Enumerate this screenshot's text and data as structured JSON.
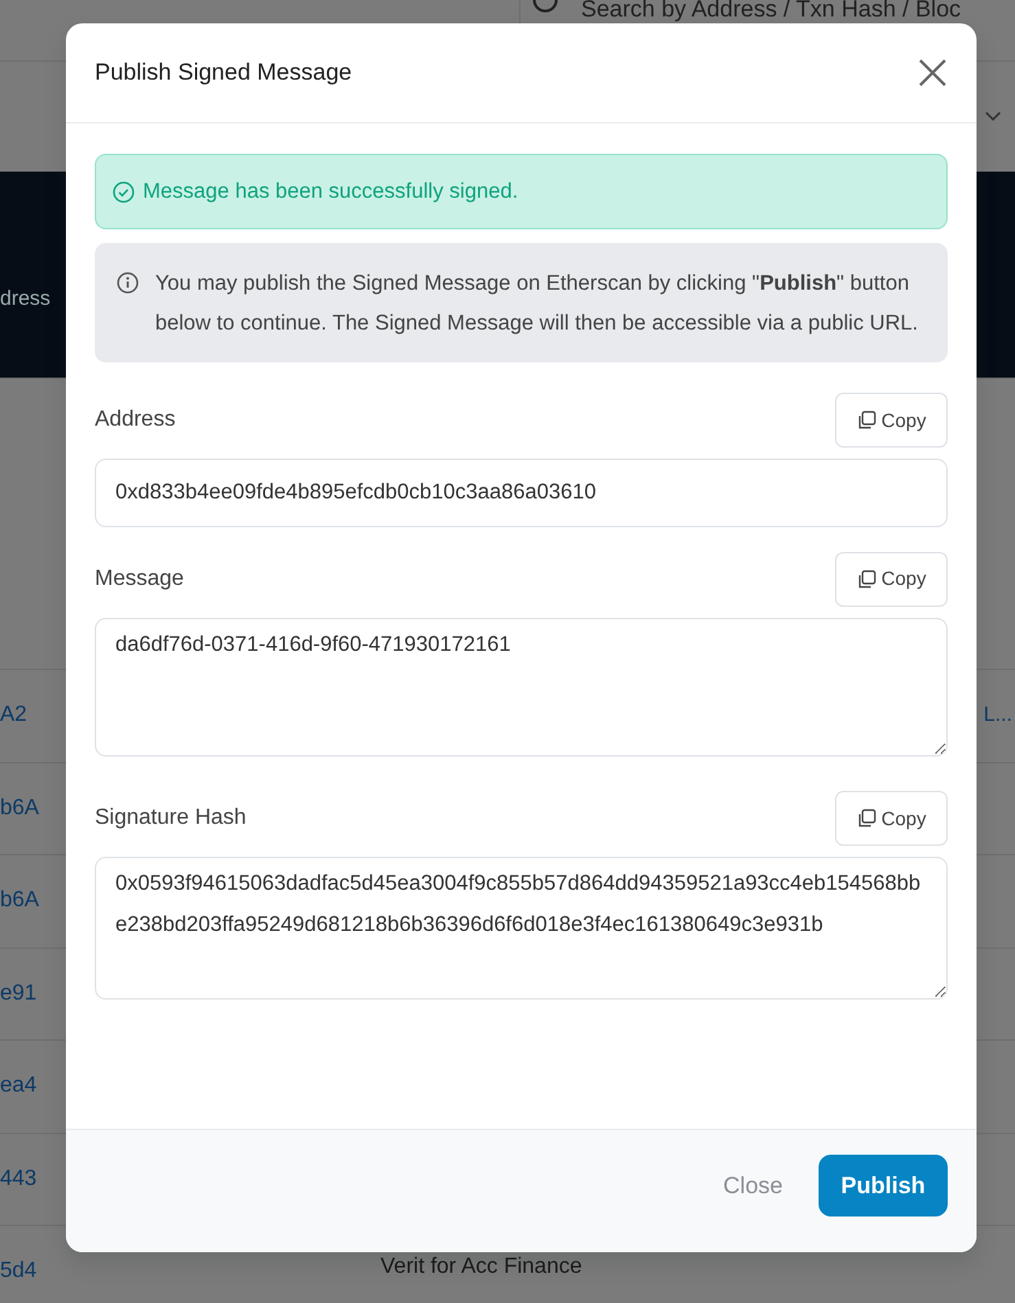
{
  "background": {
    "search_placeholder": "Search by Address / Txn Hash / Bloc",
    "hero_text": "dress",
    "rows": [
      {
        "hash": "A2",
        "extra": "L..."
      },
      {
        "hash": "b6A"
      },
      {
        "hash": "b6A"
      },
      {
        "hash": "e91"
      },
      {
        "hash": "ea4"
      },
      {
        "hash": "443"
      },
      {
        "hash": "5d4",
        "name": "Verit for Acc Finance"
      }
    ]
  },
  "modal": {
    "title": "Publish Signed Message",
    "success": "Message has been successfully signed.",
    "info": "You may publish the Signed Message on Etherscan by clicking \"**Publish**\" button below to continue. The Signed Message will then be accessible via a public URL.",
    "fields": [
      {
        "label": "Address",
        "kind": "input",
        "value": "0xd833b4ee09fde4b895efcdb0cb10c3aa86a03610",
        "copy": "Copy"
      },
      {
        "label": "Message",
        "kind": "textarea",
        "value": "da6df76d-0371-416d-9f60-471930172161",
        "copy": "Copy"
      },
      {
        "label": "Signature Hash",
        "kind": "textarea",
        "value": "0x0593f94615063dadfac5d45ea3004f9c855b57d864dd94359521a93cc4eb154568bbe238bd203ffa95249d681218b6b36396d6f6d018e3f4ec161380649c3e931b",
        "copy": "Copy"
      }
    ],
    "buttons": [
      {
        "label": "Close",
        "kind": "link"
      },
      {
        "label": "Publish",
        "kind": "primary"
      }
    ]
  }
}
